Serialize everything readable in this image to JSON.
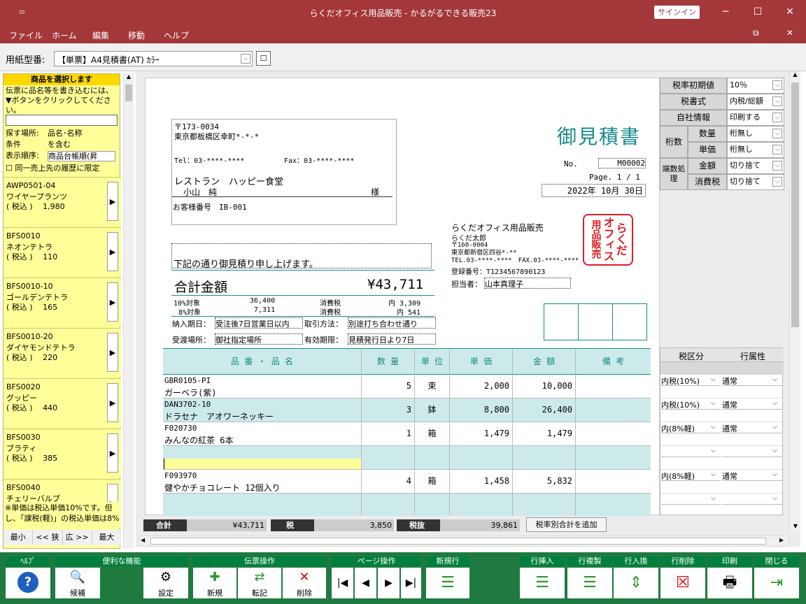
{
  "titlebar": {
    "title": "らくだオフィス用品販売 - かるがるできる販売23",
    "signin": "サインイン"
  },
  "menu": [
    "ファイル",
    "ホーム",
    "編集",
    "移動",
    "ヘルプ"
  ],
  "paper": {
    "label": "用紙型番:",
    "value": "【単票】A4見積書(AT) ｶﾗｰ"
  },
  "left": {
    "title": "商品を選択します",
    "help": "伝票に品名等を書き込むには、▼ボタンをクリックしてください。",
    "search_label": "探す場所:",
    "search_value": "品名･名称",
    "cond_label": "条件",
    "cond_value": "を含む",
    "order_label": "表示順序:",
    "order_value": "商品台帳順(昇",
    "check_label": "同一売上先の履歴に限定",
    "items": [
      {
        "code": "AWP0501-04",
        "name": "ワイヤープランツ",
        "price": "( 税込 )　 1,980"
      },
      {
        "code": "BFS0010",
        "name": "ネオンテトラ",
        "price": "( 税込 )　 110"
      },
      {
        "code": "BFS0010-10",
        "name": "ゴールデンテトラ",
        "price": "( 税込 )　 165"
      },
      {
        "code": "BFS0010-20",
        "name": "ダイヤモンドテトラ",
        "price": "( 税込 )　 220"
      },
      {
        "code": "BFS0020",
        "name": "グッピー",
        "price": "( 税込 )　 440"
      },
      {
        "code": "BFS0030",
        "name": "プラティ",
        "price": "( 税込 )　 385"
      },
      {
        "code": "BFS0040",
        "name": "チェリーバルブ",
        "price": ""
      }
    ],
    "note": "※単価は税込単価10%です。但し、「課税(軽)」の税込単価は8%",
    "nav": [
      "最小",
      "<< 狭",
      "広 >>",
      "最大"
    ]
  },
  "doc": {
    "postal": "〒173-0034",
    "addr": "東京都板橋区幸町*-*-*",
    "tel": "Tel：03-****-****",
    "fax": "Fax：03-****-****",
    "customer": "レストラン　ハッピー食堂",
    "person": "小山　純",
    "sama": "様",
    "custno": "お客様番号　IB-001",
    "title": "御見積書",
    "no_label": "No.",
    "no": "M00002",
    "page": "Page. 1 / 1",
    "date": "2022年 10月 30日",
    "intro": "下記の通り御見積り申し上げます。",
    "total_label": "合計金額",
    "total": "¥43,711",
    "tax10_label": "10%対象",
    "tax10_amt": "36,400",
    "tax10_tax_label": "消費税",
    "tax10_tax": "内 3,309",
    "tax8_label": "8%対象",
    "tax8_amt": "7,311",
    "tax8_tax_label": "消費税",
    "tax8_tax": "内 541",
    "delivery_label": "納入期日：",
    "delivery": "受注後7日営業日以内",
    "payment_label": "取引方法：",
    "payment": "別途打ち合わせ通り",
    "place_label": "受渡場所：",
    "place": "御社指定場所",
    "valid_label": "有効期限：",
    "valid": "見積発行日より7日",
    "company": "らくだオフィス用品販売",
    "rep": "らくだ太郎",
    "cpostal": "〒160-0004",
    "caddr": "東京都新宿区四谷*-**",
    "ctel": "TEL.03-****-****　FAX.03-****-****",
    "reg": "登録番号：T1234567890123",
    "staff_label": "担当者：",
    "staff": "山本真理子",
    "stamp": "らくだオフィス用品販売",
    "headers": [
      "品 番 ・ 品 名",
      "数 量",
      "単 位",
      "単 価",
      "金 額",
      "備 考"
    ],
    "rows": [
      {
        "code": "GBR0105-PI",
        "name": "ガーベラ(紫)",
        "qty": "5",
        "unit": "束",
        "price": "2,000",
        "amount": "10,000"
      },
      {
        "code": "DAN3702-10",
        "name": "ドラセナ　アオワーネッキー",
        "qty": "3",
        "unit": "鉢",
        "price": "8,800",
        "amount": "26,400"
      },
      {
        "code": "F020730",
        "name": "みんなの紅茶 6本",
        "qty": "1",
        "unit": "箱",
        "price": "1,479",
        "amount": "1,479"
      },
      {
        "code": "",
        "name": "",
        "qty": "",
        "unit": "",
        "price": "",
        "amount": ""
      },
      {
        "code": "F093970",
        "name": "健やかチョコレート 12個入り",
        "qty": "4",
        "unit": "箱",
        "price": "1,458",
        "amount": "5,832"
      },
      {
        "code": "",
        "name": "",
        "qty": "",
        "unit": "",
        "price": "",
        "amount": ""
      }
    ]
  },
  "right": {
    "tax_init_label": "税率初期値",
    "tax_init": "10％",
    "book_label": "税書式",
    "book": "内税/総額",
    "self_label": "自社情報",
    "self": "印刷する",
    "keta": "桁数",
    "qty_label": "数量",
    "qty": "桁無し",
    "unit_label": "単価",
    "unit": "桁無し",
    "hasu": "端数処理",
    "amt_label": "金額",
    "amt": "切り捨て",
    "tax_label": "消費税",
    "tax": "切り捨て",
    "col1": "税区分",
    "col2": "行属性",
    "rows": [
      {
        "kbn": "内税(10%)",
        "attr": "通常"
      },
      {
        "kbn": "内税(10%)",
        "attr": "通常"
      },
      {
        "kbn": "内(8%軽)",
        "attr": "通常"
      },
      {
        "kbn": "",
        "attr": ""
      },
      {
        "kbn": "内(8%軽)",
        "attr": "通常"
      },
      {
        "kbn": "",
        "attr": ""
      }
    ]
  },
  "totals": {
    "sum_label": "合計",
    "sum": "¥43,711",
    "tax_label": "税",
    "tax": "3,850",
    "ex_label": "税抜",
    "ex": "39,861",
    "add": "税率別合計を追加"
  },
  "bottom": {
    "groups": [
      "ﾍﾙﾌﾟ",
      "便利な機能",
      "伝票操作",
      "ページ操作",
      "新規行",
      "行挿入",
      "行複製",
      "行入換",
      "行削除",
      "印刷",
      "閉じる"
    ],
    "buttons": [
      "候補",
      "設定",
      "新規",
      "転記",
      "削除"
    ]
  }
}
